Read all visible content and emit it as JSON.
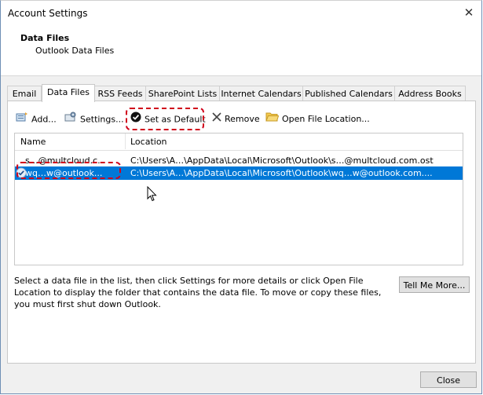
{
  "window": {
    "title": "Account Settings"
  },
  "header": {
    "title": "Data Files",
    "subtitle": "Outlook Data Files"
  },
  "tabs": [
    {
      "label": "Email"
    },
    {
      "label": "Data Files"
    },
    {
      "label": "RSS Feeds"
    },
    {
      "label": "SharePoint Lists"
    },
    {
      "label": "Internet Calendars"
    },
    {
      "label": "Published Calendars"
    },
    {
      "label": "Address Books"
    }
  ],
  "toolbar": {
    "add": "Add...",
    "settings": "Settings...",
    "set_default": "Set as Default",
    "remove": "Remove",
    "open_location": "Open File Location..."
  },
  "list": {
    "headers": {
      "name": "Name",
      "location": "Location"
    },
    "rows": [
      {
        "name": "s…@multcloud.c...",
        "location": "C:\\Users\\A…\\AppData\\Local\\Microsoft\\Outlook\\s…@multcloud.com.ost",
        "selected": false
      },
      {
        "name": "wq…w@outlook...",
        "location": "C:\\Users\\A…\\AppData\\Local\\Microsoft\\Outlook\\wq…w@outlook.com....",
        "selected": true
      }
    ]
  },
  "description": "Select a data file in the list, then click Settings for more details or click Open File Location to display the folder that contains the data file. To move or copy these files, you must first shut down Outlook.",
  "buttons": {
    "tell_me_more": "Tell Me More...",
    "close": "Close"
  },
  "colors": {
    "selection": "#0078d7",
    "annotation": "#d0021b"
  }
}
